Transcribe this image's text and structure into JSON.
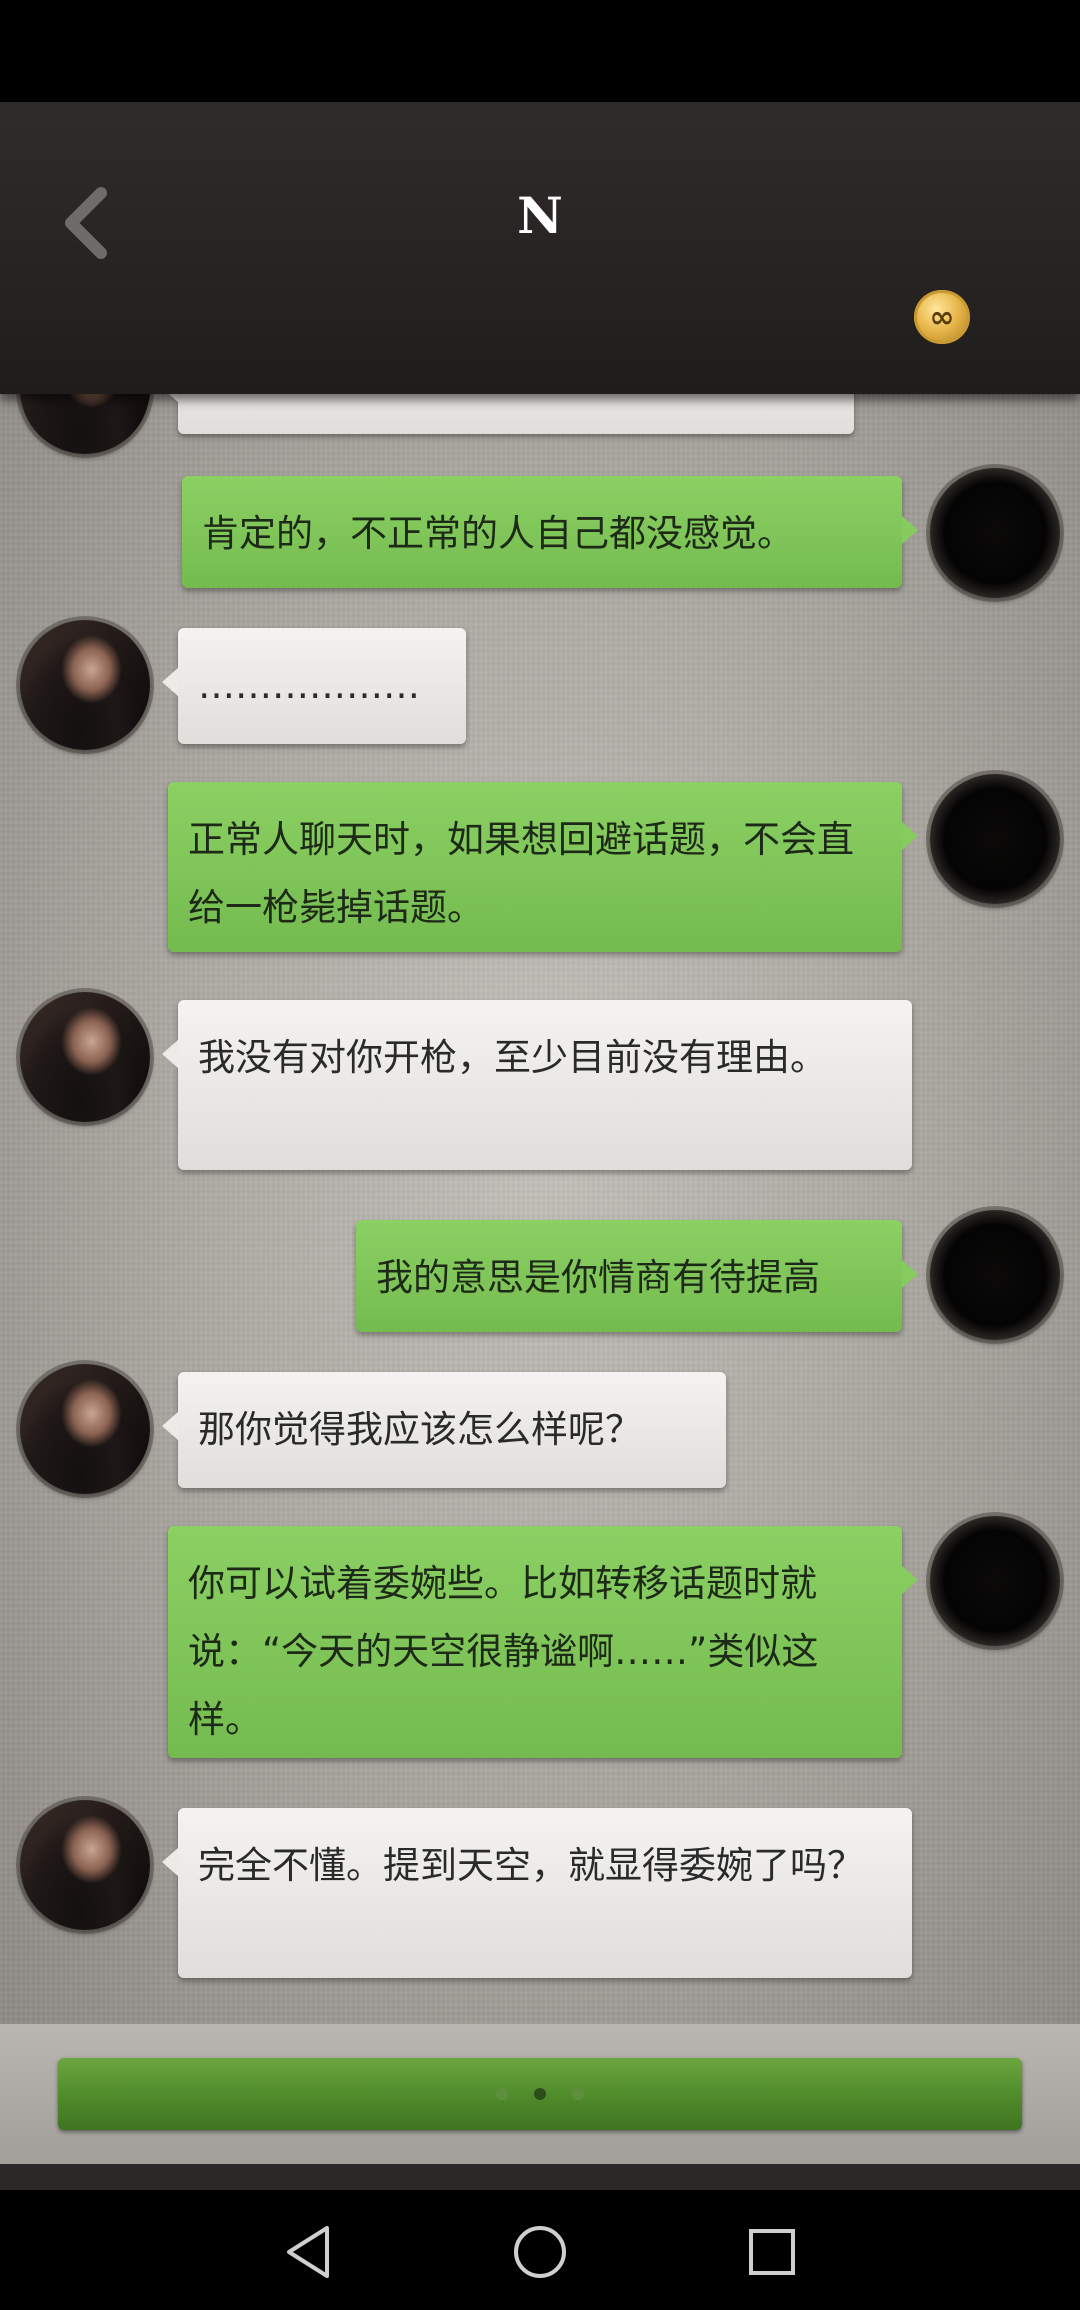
{
  "header": {
    "title": "N",
    "back_icon": "back-chevron-icon",
    "coin_icon": "infinity-coin-icon",
    "coin_symbol": "∞"
  },
  "messages": [
    {
      "side": "right",
      "text": "肯定的，不正常的人自己都没感觉。"
    },
    {
      "side": "left",
      "text": "………………"
    },
    {
      "side": "right",
      "text": "正常人聊天时，如果想回避话题，不会直给一枪毙掉话题。"
    },
    {
      "side": "left",
      "text": "我没有对你开枪，至少目前没有理由。"
    },
    {
      "side": "right",
      "text": "我的意思是你情商有待提高"
    },
    {
      "side": "left",
      "text": "那你觉得我应该怎么样呢？"
    },
    {
      "side": "right",
      "text": "你可以试着委婉些。比如转移话题时就说：“今天的天空很静谧啊……”类似这样。"
    },
    {
      "side": "left",
      "text": "完全不懂。提到天空，就显得委婉了吗？"
    }
  ],
  "input_bar": {
    "pager_dots": 3,
    "active_dot": 1
  },
  "nav": {
    "back_icon": "triangle-back-icon",
    "home_icon": "circle-home-icon",
    "recents_icon": "square-recents-icon"
  },
  "colors": {
    "header_bg": "#2a2726",
    "bubble_left": "#eceae7",
    "bubble_right": "#7fc458",
    "action_button": "#5a952f"
  }
}
